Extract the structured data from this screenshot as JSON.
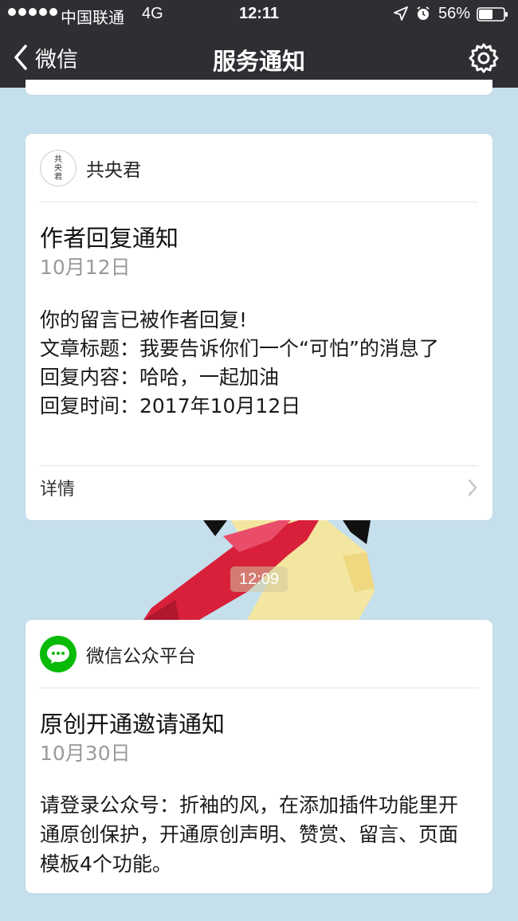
{
  "status_bar": {
    "carrier": "中国联通",
    "network": "4G",
    "time": "12:11",
    "battery": "56%"
  },
  "nav": {
    "back_label": "微信",
    "title": "服务通知"
  },
  "messages": [
    {
      "sender": "共央君",
      "avatar_text": [
        "共",
        "央",
        "君"
      ],
      "title": "作者回复通知",
      "date": "10月12日",
      "body": [
        "你的留言已被作者回复!",
        "文章标题：我要告诉你们一个“可怕”的消息了",
        "回复内容：哈哈，一起加油",
        "回复时间：2017年10月12日"
      ],
      "detail_label": "详情"
    },
    {
      "sender": "微信公众平台",
      "title": "原创开通邀请通知",
      "date": "10月30日",
      "body": [
        "请登录公众号：折袖的风，在添加插件功能里开通原创保护，开通原创声明、赞赏、留言、页面模板4个功能。"
      ]
    }
  ],
  "timestamp": "12:09",
  "colors": {
    "bar": "#2e2e33",
    "background": "#c5dfec",
    "wechat_green": "#09bb07",
    "date_gray": "#9a9a9a"
  }
}
